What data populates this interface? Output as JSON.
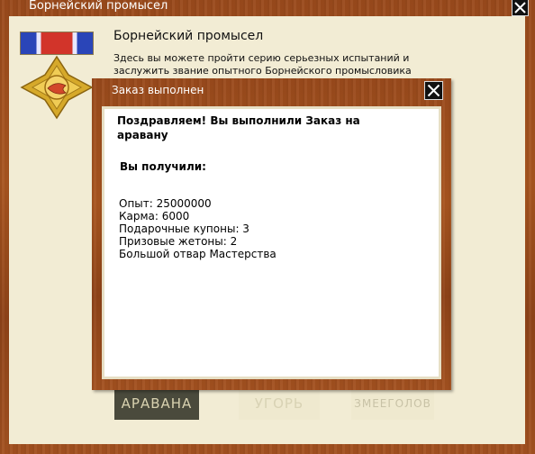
{
  "outer": {
    "title": "Борнейский промысел",
    "heading": "Борнейский промысел",
    "description": "Здесь вы можете пройти серию серьезных испытаний и заслужить звание опытного Борнейского промысловика"
  },
  "tabs": [
    {
      "label": "АРАВАНА"
    },
    {
      "label": "УГОРЬ"
    },
    {
      "label": "ЗМЕЕГОЛОВ"
    }
  ],
  "dialog": {
    "title": "Заказ выполнен",
    "congrats": "Поздравляем! Вы выполнили Заказ на аравану",
    "received_label": "Вы получили:",
    "rewards": [
      "Опыт: 25000000",
      "Карма: 6000",
      "Подарочные купоны: 3",
      "Призовые жетоны: 2",
      "Большой отвар Мастерства"
    ]
  },
  "colors": {
    "wood": "#a0501e",
    "panel_bg": "#f2ecd4",
    "active_tab": "#4a4a3c"
  },
  "icons": [
    "close-icon",
    "ribbon-icon",
    "medal-icon"
  ]
}
